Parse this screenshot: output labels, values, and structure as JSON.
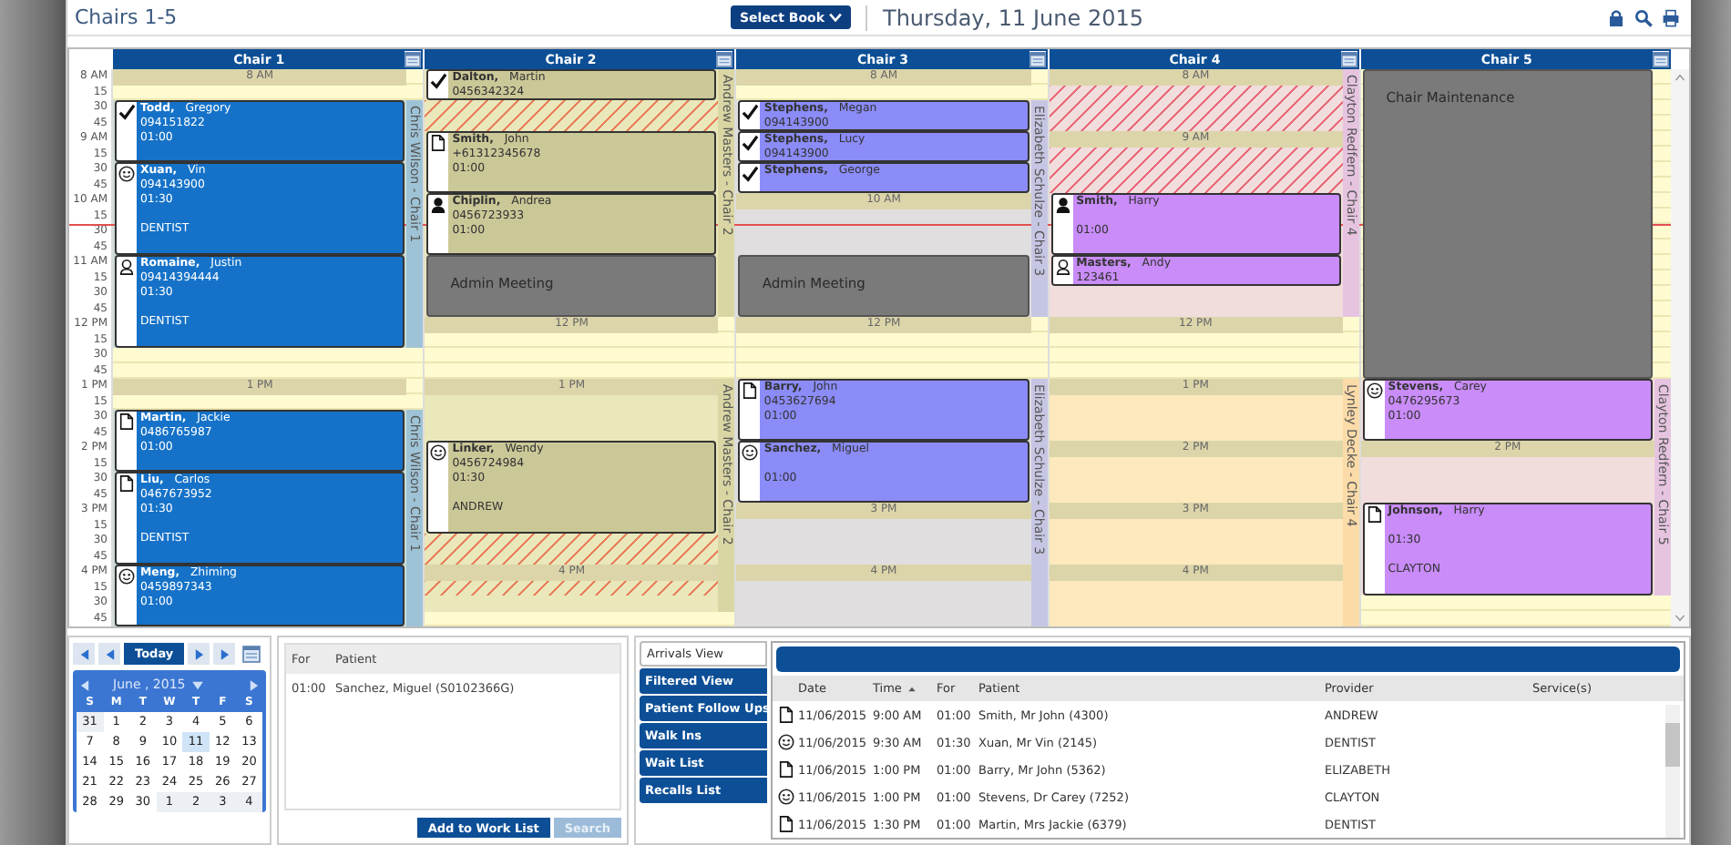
{
  "header": {
    "title": "Chairs 1-5",
    "book_button": "Select Book",
    "date": "Thursday, 11 June 2015"
  },
  "schedule": {
    "time_labels": [
      "8 AM",
      "15",
      "30",
      "45",
      "9 AM",
      "15",
      "30",
      "45",
      "10 AM",
      "15",
      "30",
      "45",
      "11 AM",
      "15",
      "30",
      "45",
      "12 PM",
      "15",
      "30",
      "45",
      "1 PM",
      "15",
      "30",
      "45",
      "2 PM",
      "15",
      "30",
      "45",
      "3 PM",
      "15",
      "30",
      "45",
      "4 PM",
      "15",
      "30",
      "45"
    ],
    "chairs": [
      {
        "name": "Chair 1",
        "color": "#1572c8",
        "providers": [
          {
            "label": "Chris Wilson - Chair 1",
            "color": "#9fc3d6"
          },
          {
            "label": "Chris Wilson - Chair 1",
            "color": "#9fc3d6"
          }
        ],
        "blocks": [
          {
            "kind": "band",
            "label": "8 AM"
          },
          {
            "kind": "check",
            "surname": "Todd,",
            "given": "Gregory",
            "phone": "094151822",
            "duration": "01:00"
          },
          {
            "kind": "smiley",
            "surname": "Xuan,",
            "given": "Vin",
            "phone": "094143900",
            "duration": "01:30",
            "note": "DENTIST"
          },
          {
            "kind": "person-outline",
            "surname": "Romaine,",
            "given": "Justin",
            "phone": "09414394444",
            "duration": "01:30",
            "note": "DENTIST"
          },
          {
            "kind": "band",
            "label": "1 PM"
          },
          {
            "kind": "document",
            "surname": "Martin,",
            "given": "Jackie",
            "phone": "0486765987",
            "duration": "01:00"
          },
          {
            "kind": "document",
            "surname": "Liu,",
            "given": "Carlos",
            "phone": "0467673952",
            "duration": "01:30",
            "note": "DENTIST"
          },
          {
            "kind": "smiley",
            "surname": "Meng,",
            "given": "Zhiming",
            "phone": "0459897343",
            "duration": "01:00"
          }
        ]
      },
      {
        "name": "Chair 2",
        "color": "#cbc898",
        "providers": [
          {
            "label": "Andrew Masters - Chair 2",
            "color": "#d9d6a4"
          },
          {
            "label": "Andrew Masters - Chair 2",
            "color": "#d9d6a4"
          }
        ],
        "blocks": [
          {
            "kind": "check",
            "surname": "Dalton,",
            "given": "Martin",
            "phone": "0456342324"
          },
          {
            "kind": "blocked",
            "color": "#e8805a"
          },
          {
            "kind": "document",
            "surname": "Smith,",
            "given": "John",
            "phone": "+61312345678",
            "duration": "01:00"
          },
          {
            "kind": "person",
            "surname": "Chiplin,",
            "given": "Andrea",
            "phone": "0456723933",
            "duration": "01:00"
          },
          {
            "kind": "meeting",
            "label": "Admin Meeting"
          },
          {
            "kind": "band",
            "label": "12 PM"
          },
          {
            "kind": "band",
            "label": "1 PM"
          },
          {
            "kind": "smiley",
            "surname": "Linker,",
            "given": "Wendy",
            "phone": "0456724984",
            "duration": "01:30",
            "note": "ANDREW"
          },
          {
            "kind": "blocked",
            "color": "#e8805a"
          },
          {
            "kind": "band",
            "label": "4 PM"
          }
        ]
      },
      {
        "name": "Chair 3",
        "color": "#8b8cf8",
        "providers": [
          {
            "label": "Elizabeth Schulze - Chair 3",
            "color": "#c6c6e4"
          },
          {
            "label": "Elizabeth Schulze - Chair 3",
            "color": "#c6c6e4"
          }
        ],
        "blocks": [
          {
            "kind": "band",
            "label": "8 AM"
          },
          {
            "kind": "check",
            "surname": "Stephens,",
            "given": "Megan",
            "phone": "094143900"
          },
          {
            "kind": "check",
            "surname": "Stephens,",
            "given": "Lucy",
            "phone": "094143900"
          },
          {
            "kind": "check",
            "surname": "Stephens,",
            "given": "George"
          },
          {
            "kind": "band",
            "label": "10 AM"
          },
          {
            "kind": "meeting",
            "label": "Admin Meeting"
          },
          {
            "kind": "band",
            "label": "12 PM"
          },
          {
            "kind": "document",
            "surname": "Barry,",
            "given": "John",
            "phone": "0453627694",
            "duration": "01:00"
          },
          {
            "kind": "smiley",
            "surname": "Sanchez,",
            "given": "Miguel",
            "duration": "01:00"
          },
          {
            "kind": "band",
            "label": "3 PM"
          },
          {
            "kind": "band",
            "label": "4 PM"
          }
        ]
      },
      {
        "name": "Chair 4",
        "color": "#c98cf8",
        "providers": [
          {
            "label": "Clayton Redfern - Chair 4",
            "color": "#e6c4e0"
          },
          {
            "label": "Lynley Decke - Chair 4",
            "color": "#fbdba8"
          }
        ],
        "blocks": [
          {
            "kind": "blocked",
            "color": "#e86a7a"
          },
          {
            "kind": "band",
            "label": "8 AM"
          },
          {
            "kind": "band",
            "label": "9 AM"
          },
          {
            "kind": "person",
            "surname": "Smith,",
            "given": "Harry",
            "duration": "01:00"
          },
          {
            "kind": "person-outline",
            "surname": "Masters,",
            "given": "Andy",
            "phone": "123461"
          },
          {
            "kind": "band",
            "label": "12 PM"
          },
          {
            "kind": "band",
            "label": "1 PM"
          },
          {
            "kind": "band",
            "label": "2 PM"
          },
          {
            "kind": "band",
            "label": "3 PM"
          },
          {
            "kind": "band",
            "label": "4 PM"
          }
        ]
      },
      {
        "name": "Chair 5",
        "color": "#c98cf8",
        "providers": [
          {
            "label": "Clayton Redfern - Chair 5",
            "color": "#e6c4e0"
          }
        ],
        "blocks": [
          {
            "kind": "meeting",
            "label": "Chair Maintenance"
          },
          {
            "kind": "smiley",
            "surname": "Stevens,",
            "given": "Carey",
            "phone": "0476295673",
            "duration": "01:00"
          },
          {
            "kind": "band",
            "label": "2 PM"
          },
          {
            "kind": "document",
            "surname": "Johnson,",
            "given": "Harry",
            "duration": "01:30",
            "note": "CLAYTON"
          }
        ]
      }
    ]
  },
  "navigator": {
    "today_button": "Today",
    "month": "June , 2015",
    "weekdays": [
      "S",
      "M",
      "T",
      "W",
      "T",
      "F",
      "S"
    ],
    "weeks": [
      [
        {
          "label": "31",
          "selected": false,
          "outside": true
        },
        {
          "label": "1",
          "selected": false,
          "outside": false
        },
        {
          "label": "2",
          "selected": false,
          "outside": false
        },
        {
          "label": "3",
          "selected": false,
          "outside": false
        },
        {
          "label": "4",
          "selected": false,
          "outside": false
        },
        {
          "label": "5",
          "selected": false,
          "outside": false
        },
        {
          "label": "6",
          "selected": false,
          "outside": false
        }
      ],
      [
        {
          "label": "7",
          "selected": false,
          "outside": false
        },
        {
          "label": "8",
          "selected": false,
          "outside": false
        },
        {
          "label": "9",
          "selected": false,
          "outside": false
        },
        {
          "label": "10",
          "selected": false,
          "outside": false
        },
        {
          "label": "11",
          "selected": true,
          "outside": false
        },
        {
          "label": "12",
          "selected": false,
          "outside": false
        },
        {
          "label": "13",
          "selected": false,
          "outside": false
        }
      ],
      [
        {
          "label": "14",
          "selected": false,
          "outside": false
        },
        {
          "label": "15",
          "selected": false,
          "outside": false
        },
        {
          "label": "16",
          "selected": false,
          "outside": false
        },
        {
          "label": "17",
          "selected": false,
          "outside": false
        },
        {
          "label": "18",
          "selected": false,
          "outside": false
        },
        {
          "label": "19",
          "selected": false,
          "outside": false
        },
        {
          "label": "20",
          "selected": false,
          "outside": false
        }
      ],
      [
        {
          "label": "21",
          "selected": false,
          "outside": false
        },
        {
          "label": "22",
          "selected": false,
          "outside": false
        },
        {
          "label": "23",
          "selected": false,
          "outside": false
        },
        {
          "label": "24",
          "selected": false,
          "outside": false
        },
        {
          "label": "25",
          "selected": false,
          "outside": false
        },
        {
          "label": "26",
          "selected": false,
          "outside": false
        },
        {
          "label": "27",
          "selected": false,
          "outside": false
        }
      ],
      [
        {
          "label": "28",
          "selected": false,
          "outside": false
        },
        {
          "label": "29",
          "selected": false,
          "outside": false
        },
        {
          "label": "30",
          "selected": false,
          "outside": false
        },
        {
          "label": "1",
          "selected": false,
          "outside": true
        },
        {
          "label": "2",
          "selected": false,
          "outside": true
        },
        {
          "label": "3",
          "selected": false,
          "outside": true
        },
        {
          "label": "4",
          "selected": false,
          "outside": true
        }
      ]
    ]
  },
  "work_list": {
    "columns": [
      "For",
      "Patient"
    ],
    "rows": [
      {
        "for": "01:00",
        "patient": "Sanchez, Miguel (S0102366G)"
      }
    ],
    "buttons": [
      {
        "label": "Add to Work List",
        "disabled": false
      },
      {
        "label": "Search",
        "disabled": true
      }
    ]
  },
  "arrivals": {
    "tabs": [
      {
        "label": "Arrivals View",
        "selected": true
      },
      {
        "label": "Filtered View",
        "selected": false
      },
      {
        "label": "Patient Follow Ups",
        "selected": false
      },
      {
        "label": "Walk Ins",
        "selected": false
      },
      {
        "label": "Wait List",
        "selected": false
      },
      {
        "label": "Recalls List",
        "selected": false
      }
    ],
    "columns": [
      "Date",
      "Time",
      "For",
      "Patient",
      "Provider",
      "Service(s)"
    ],
    "rows": [
      {
        "kind": "document",
        "date": "11/06/2015",
        "time": "9:00 AM",
        "for": "01:00",
        "patient": "Smith, Mr John (4300)",
        "provider": "ANDREW"
      },
      {
        "kind": "smiley",
        "date": "11/06/2015",
        "time": "9:30 AM",
        "for": "01:30",
        "patient": "Xuan, Mr Vin (2145)",
        "provider": "DENTIST"
      },
      {
        "kind": "document",
        "date": "11/06/2015",
        "time": "1:00 PM",
        "for": "01:00",
        "patient": "Barry, Mr John (5362)",
        "provider": "ELIZABETH"
      },
      {
        "kind": "smiley",
        "date": "11/06/2015",
        "time": "1:00 PM",
        "for": "01:00",
        "patient": "Stevens, Dr Carey (7252)",
        "provider": "CLAYTON"
      },
      {
        "kind": "document",
        "date": "11/06/2015",
        "time": "1:30 PM",
        "for": "01:00",
        "patient": "Martin, Mrs Jackie (6379)",
        "provider": "DENTIST"
      }
    ]
  }
}
